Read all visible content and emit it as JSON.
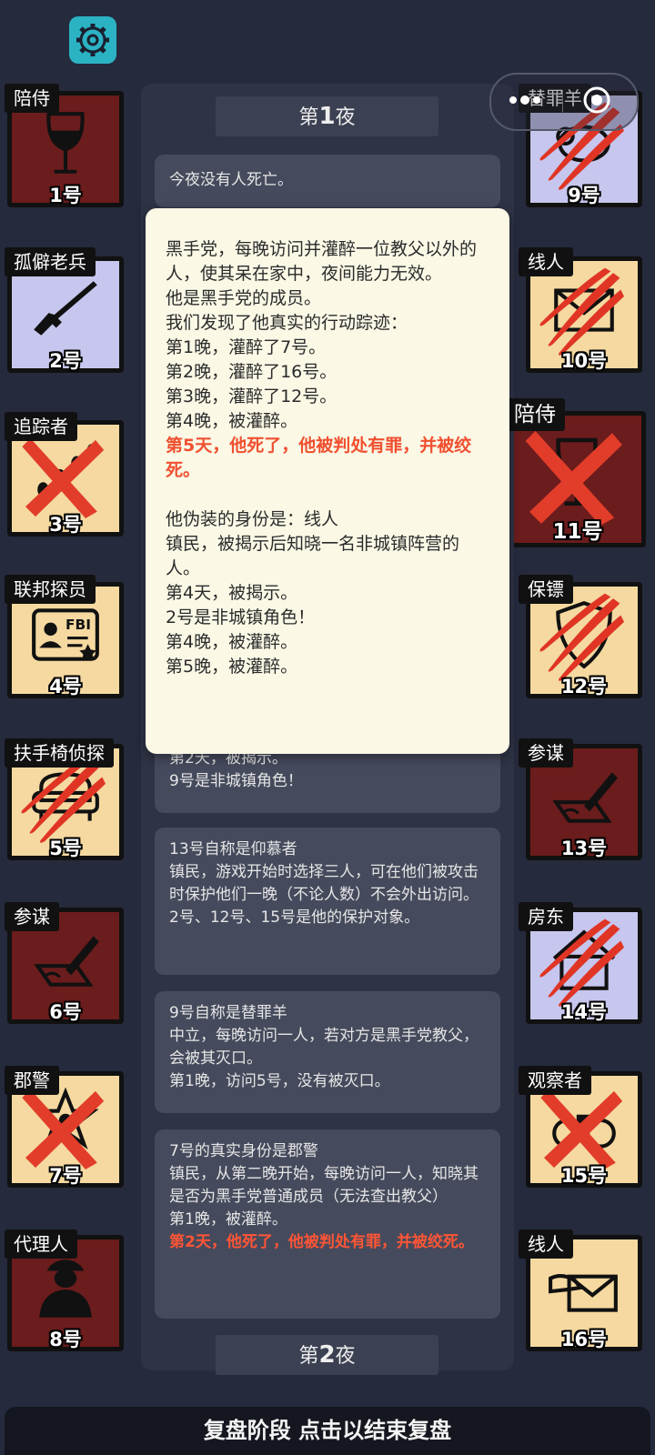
{
  "capsule": {
    "menu_icon": "more-dots-icon",
    "close_icon": "target-circle-icon"
  },
  "settings": {
    "icon": "gear-icon",
    "color": "#2bb3c4"
  },
  "players": [
    {
      "num": "1号",
      "role": "陪侍",
      "icon": "wine-glass-icon",
      "status": "none"
    },
    {
      "num": "2号",
      "role": "孤僻老兵",
      "icon": "rifle-icon",
      "status": "none"
    },
    {
      "num": "3号",
      "role": "追踪者",
      "icon": "tracker-icon",
      "status": "x"
    },
    {
      "num": "4号",
      "role": "联邦探员",
      "icon": "fbi-badge-icon",
      "status": "none"
    },
    {
      "num": "5号",
      "role": "扶手椅侦探",
      "icon": "armchair-icon",
      "status": "claw"
    },
    {
      "num": "6号",
      "role": "参谋",
      "icon": "pen-paper-icon",
      "status": "none"
    },
    {
      "num": "7号",
      "role": "郡警",
      "icon": "sheriff-star-icon",
      "status": "x"
    },
    {
      "num": "8号",
      "role": "代理人",
      "icon": "agent-suit-icon",
      "status": "none"
    },
    {
      "num": "9号",
      "role": "替罪羊",
      "icon": "sheep-icon",
      "status": "claw"
    },
    {
      "num": "10号",
      "role": "线人",
      "icon": "envelope-icon",
      "status": "claw"
    },
    {
      "num": "11号",
      "role": "陪侍",
      "icon": "wine-glass-icon",
      "status": "x"
    },
    {
      "num": "12号",
      "role": "保镖",
      "icon": "shield-icon",
      "status": "claw"
    },
    {
      "num": "13号",
      "role": "参谋",
      "icon": "pen-paper-icon",
      "status": "none"
    },
    {
      "num": "14号",
      "role": "房东",
      "icon": "house-icon",
      "status": "claw"
    },
    {
      "num": "15号",
      "role": "观察者",
      "icon": "binoculars-icon",
      "status": "x"
    },
    {
      "num": "16号",
      "role": "线人",
      "icon": "envelope-hand-icon",
      "status": "none"
    }
  ],
  "nights": {
    "n1_pre": "第",
    "n1_num": "1",
    "n1_post": "夜",
    "n2_pre": "第",
    "n2_num": "2",
    "n2_post": "夜"
  },
  "logs": {
    "l1": "今夜没有人死亡。",
    "l2": [
      "第2天，被揭示。",
      "9号是非城镇角色！"
    ],
    "l3": [
      "13号自称是仰慕者",
      "镇民，游戏开始时选择三人，可在他们被攻击时保护他们一晚（不论人数）不会外出访问。",
      "2号、12号、15号是他的保护对象。"
    ],
    "l4": [
      "9号自称是替罪羊",
      "中立，每晚访问一人，若对方是黑手党教父，会被其灭口。",
      "第1晚，访问5号，没有被灭口。"
    ],
    "l5": [
      "7号的真实身份是郡警",
      "镇民，从第二晚开始，每晚访问一人，知晓其是否为黑手党普通成员（无法查出教父）",
      "第1晚，被灌醉。",
      "第2天，他死了，他被判处有罪，并被绞死。"
    ]
  },
  "popup": {
    "p1": "黑手党，每晚访问并灌醉一位教父以外的人，使其呆在家中，夜间能力无效。",
    "p2": "他是黑手党的成员。",
    "p3": "我们发现了他真实的行动踪迹：",
    "p4": "第1晚，灌醉了7号。",
    "p5": "第2晚，灌醉了16号。",
    "p6": "第3晚，灌醉了12号。",
    "p7": "第4晚，被灌醉。",
    "p8": "第5天，他死了，他被判处有罪，并被绞死。",
    "p9": "他伪装的身份是：线人",
    "p10": "镇民，被揭示后知晓一名非城镇阵营的人。",
    "p11": "第4天，被揭示。",
    "p12": "2号是非城镇角色！",
    "p13": "第4晚，被灌醉。",
    "p14": "第5晚，被灌醉。"
  },
  "bottom_bar": "复盘阶段 点击以结束复盘",
  "colors": {
    "red_card": "#6b1c1c",
    "yellow_card": "#f5d9a0",
    "purple_card": "#c6c6ee",
    "death_red": "#e03a2a",
    "highlight": "#f05030"
  }
}
